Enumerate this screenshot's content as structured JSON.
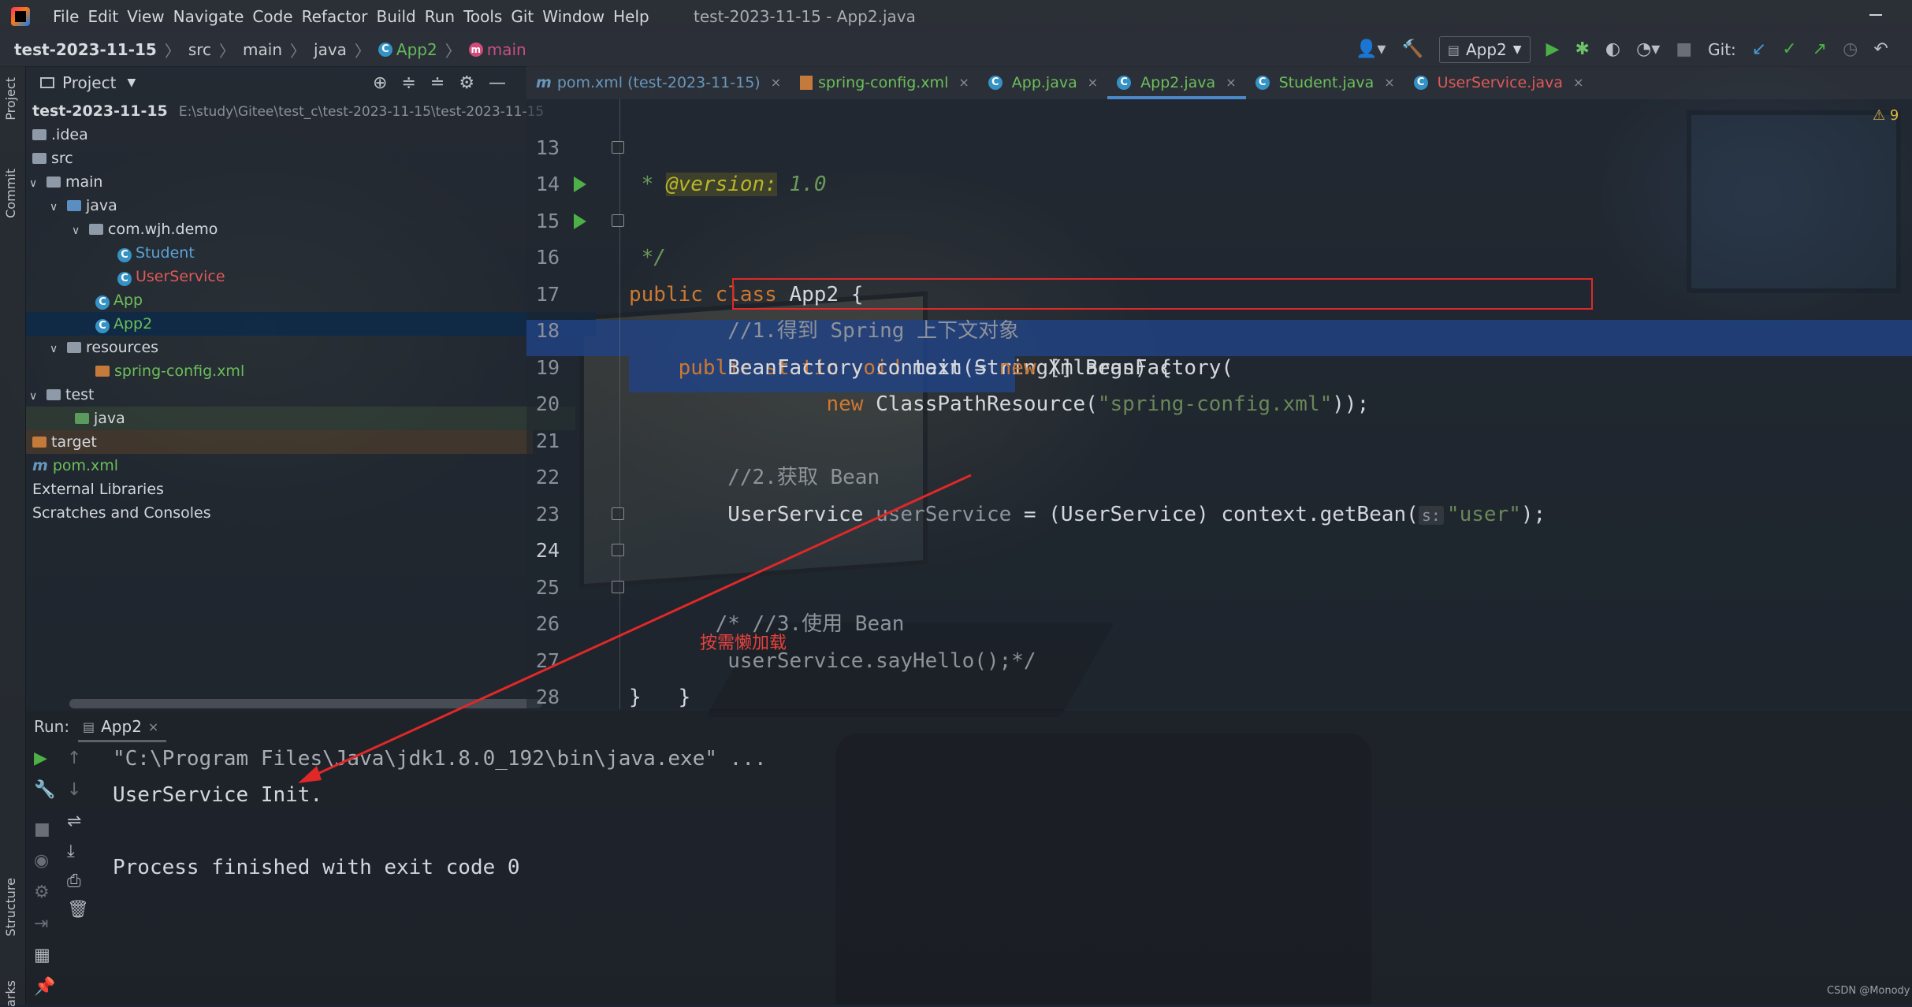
{
  "window": {
    "title": "test-2023-11-15 - App2.java"
  },
  "menu": [
    "File",
    "Edit",
    "View",
    "Navigate",
    "Code",
    "Refactor",
    "Build",
    "Run",
    "Tools",
    "Git",
    "Window",
    "Help"
  ],
  "breadcrumb": {
    "project": "test-2023-11-15",
    "items": [
      "src",
      "main",
      "java"
    ],
    "class": "App2",
    "method": "main"
  },
  "toolbar": {
    "run_config": "App2",
    "git_label": "Git:"
  },
  "left_strip": {
    "project_tab": "Project",
    "commit_tab": "Commit",
    "structure_tab": "Structure",
    "bookmarks_tab": "arks"
  },
  "project_panel": {
    "title": "Project",
    "root": {
      "name": "test-2023-11-15",
      "path": "E:\\study\\Gitee\\test_c\\test-2023-11-15\\test-2023-11-15"
    },
    "tree": [
      {
        "label": ".idea"
      },
      {
        "label": "src"
      },
      {
        "label": "main"
      },
      {
        "label": "java"
      },
      {
        "label": "com.wjh.demo"
      },
      {
        "label": "Student"
      },
      {
        "label": "UserService"
      },
      {
        "label": "App"
      },
      {
        "label": "App2"
      },
      {
        "label": "resources"
      },
      {
        "label": "spring-config.xml"
      },
      {
        "label": "test"
      },
      {
        "label": "java"
      },
      {
        "label": "target"
      },
      {
        "label": "pom.xml"
      },
      {
        "label": "External Libraries"
      },
      {
        "label": "Scratches and Consoles"
      }
    ]
  },
  "editor_tabs": [
    {
      "label": "pom.xml (test-2023-11-15)",
      "color": "#6897bb"
    },
    {
      "label": "spring-config.xml",
      "color": "#6a9a5a"
    },
    {
      "label": "App.java",
      "color": "#6a9a5a"
    },
    {
      "label": "App2.java",
      "color": "#6a9a5a"
    },
    {
      "label": "Student.java",
      "color": "#6a9a5a"
    },
    {
      "label": "UserService.java",
      "color": "#d05c5c"
    }
  ],
  "editor": {
    "line_numbers": [
      "13",
      "14",
      "15",
      "16",
      "17",
      "18",
      "19",
      "20",
      "21",
      "22",
      "23",
      "24",
      "25",
      "26",
      "27",
      "28"
    ],
    "l13_star": " * ",
    "l13_tag": "@version:",
    "l13_val": " 1.0",
    "l14": " */",
    "l15_kw": "public class",
    "l15_rest": " App2 {",
    "l16_kw": "    public static void",
    "l16_rest": " main(String[] args) {",
    "l17": "        //1.得到 Spring 上下文对象",
    "l18_a": "        BeanFactory context = ",
    "l18_kw": "new",
    "l18_b": " XmlBeanFactory(",
    "l19_kw": "                new",
    "l19_a": " ClassPathResource(",
    "l19_str": "\"spring-config.xml\"",
    "l19_b": "));",
    "l21": "        //2.获取 Bean",
    "l22_a": "        UserService ",
    "l22_var": "userService",
    "l22_b": " = (UserService) context.getBean(",
    "l22_hint": "s:",
    "l22_str": "\"user\"",
    "l22_c": ");",
    "l24": "       /* //3.使用 Bean",
    "l25": "        userService.sayHello();*/",
    "l26": "    }",
    "l27": "}",
    "warnings": "9"
  },
  "annotation": {
    "text": "按需懒加载"
  },
  "run_panel": {
    "label": "Run:",
    "tab": "App2",
    "console": [
      "\"C:\\Program Files\\Java\\jdk1.8.0_192\\bin\\java.exe\" ...",
      "UserService Init.",
      "",
      "Process finished with exit code 0"
    ]
  },
  "watermark": "CSDN @Monody"
}
